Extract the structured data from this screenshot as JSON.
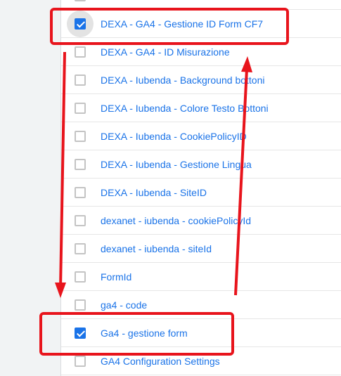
{
  "variables": [
    {
      "label": "",
      "checked": false
    },
    {
      "label": "DEXA - GA4 - Gestione ID Form CF7",
      "checked": true
    },
    {
      "label": "DEXA - GA4 - ID Misurazione",
      "checked": false
    },
    {
      "label": "DEXA - Iubenda - Background bottoni",
      "checked": false
    },
    {
      "label": "DEXA - Iubenda - Colore Testo Bottoni",
      "checked": false
    },
    {
      "label": "DEXA - Iubenda - CookiePolicyID",
      "checked": false
    },
    {
      "label": "DEXA - Iubenda - Gestione Lingua",
      "checked": false
    },
    {
      "label": "DEXA - Iubenda - SiteID",
      "checked": false
    },
    {
      "label": "dexanet - iubenda - cookiePolicyId",
      "checked": false
    },
    {
      "label": "dexanet - iubenda - siteId",
      "checked": false
    },
    {
      "label": "FormId",
      "checked": false
    },
    {
      "label": "ga4 - code",
      "checked": false
    },
    {
      "label": "Ga4 - gestione form",
      "checked": true
    },
    {
      "label": "GA4 Configuration Settings",
      "checked": false
    }
  ],
  "annotations": {
    "color": "#e8141c"
  }
}
